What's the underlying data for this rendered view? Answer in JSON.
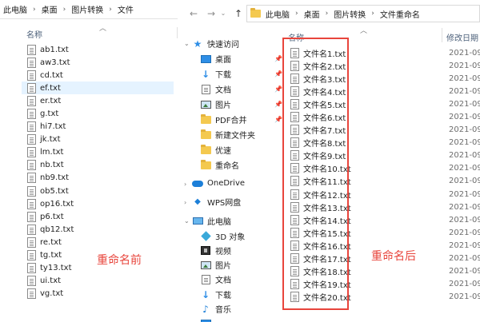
{
  "left_window": {
    "breadcrumb": [
      "此电脑",
      "桌面",
      "图片转换",
      "文件"
    ],
    "column_header": "名称",
    "files": [
      "ab1.txt",
      "aw3.txt",
      "cd.txt",
      "ef.txt",
      "er.txt",
      "g.txt",
      "hi7.txt",
      "jk.txt",
      "lm.txt",
      "nb.txt",
      "nb9.txt",
      "ob5.txt",
      "op16.txt",
      "p6.txt",
      "qb12.txt",
      "re.txt",
      "tg.txt",
      "ty13.txt",
      "ui.txt",
      "vg.txt"
    ],
    "selected_index": 3,
    "annotation": "重命名前"
  },
  "right_window": {
    "breadcrumb": [
      "此电脑",
      "桌面",
      "图片转换",
      "文件重命名"
    ],
    "nav": {
      "quick_access": "快速访问",
      "items": [
        "桌面",
        "下载",
        "文档",
        "图片",
        "PDF合并",
        "新建文件夹",
        "优速",
        "重命名"
      ],
      "onedrive": "OneDrive",
      "wps": "WPS网盘",
      "this_pc": "此电脑",
      "pc_items": [
        "3D 对象",
        "视频",
        "图片",
        "文档",
        "下载",
        "音乐"
      ]
    },
    "column_headers": {
      "name": "名称",
      "modified": "修改日期"
    },
    "files": [
      "文件名1.txt",
      "文件名2.txt",
      "文件名3.txt",
      "文件名4.txt",
      "文件名5.txt",
      "文件名6.txt",
      "文件名7.txt",
      "文件名8.txt",
      "文件名9.txt",
      "文件名10.txt",
      "文件名11.txt",
      "文件名12.txt",
      "文件名13.txt",
      "文件名14.txt",
      "文件名15.txt",
      "文件名16.txt",
      "文件名17.txt",
      "文件名18.txt",
      "文件名19.txt",
      "文件名20.txt"
    ],
    "file_date": "2021-09-",
    "annotation": "重命名后"
  },
  "colors": {
    "annotation_red": "#e8453c",
    "selection": "#e5f3ff",
    "header_text": "#4c607a"
  }
}
